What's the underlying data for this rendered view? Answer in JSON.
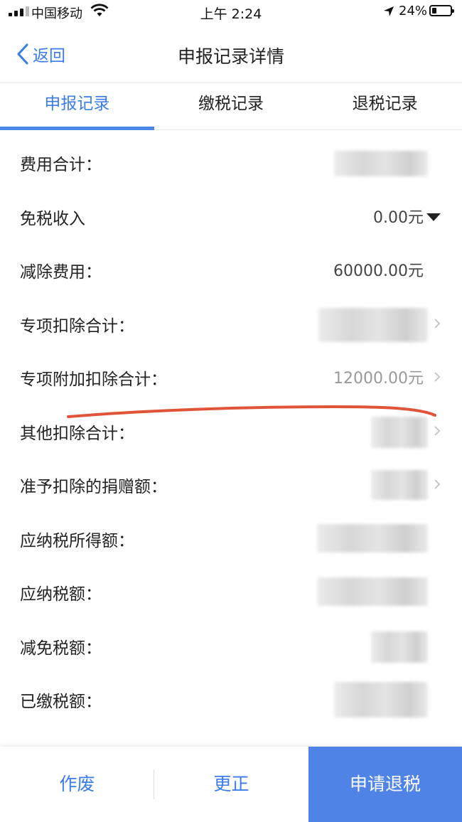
{
  "status_bar": {
    "carrier": "中国移动",
    "time": "上午 2:24",
    "battery": "24%"
  },
  "nav": {
    "back_label": "返回",
    "title": "申报记录详情"
  },
  "tabs": [
    {
      "label": "申报记录",
      "active": true
    },
    {
      "label": "缴税记录",
      "active": false
    },
    {
      "label": "退税记录",
      "active": false
    }
  ],
  "rows": [
    {
      "label": "费用合计：",
      "value": "",
      "blurred": true
    },
    {
      "label": "免税收入",
      "value": "0.00元",
      "dropdown": true
    },
    {
      "label": "减除费用：",
      "value": "60000.00元"
    },
    {
      "label": "专项扣除合计：",
      "value": "",
      "blurred": true,
      "chevron": true
    },
    {
      "label": "专项附加扣除合计：",
      "value": "12000.00元",
      "chevron": true
    },
    {
      "label": "其他扣除合计：",
      "value": "",
      "blurred": true,
      "chevron": true
    },
    {
      "label": "准予扣除的捐赠额：",
      "value": "",
      "blurred": true,
      "chevron": true
    },
    {
      "label": "应纳税所得额：",
      "value": "",
      "blurred": true
    },
    {
      "label": "应纳税额：",
      "value": "",
      "blurred": true
    },
    {
      "label": "减免税额：",
      "value": "",
      "blurred": true
    },
    {
      "label": "已缴税额：",
      "value": "",
      "blurred": true
    }
  ],
  "bottom": {
    "void_label": "作废",
    "correct_label": "更正",
    "refund_label": "申请退税"
  },
  "colors": {
    "accent": "#3b7de8",
    "primary_button": "#4f84e6",
    "annotation": "#e0553a"
  }
}
